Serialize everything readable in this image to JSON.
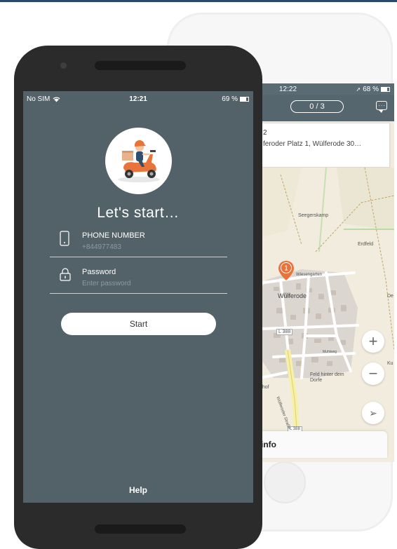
{
  "colors": {
    "screen_bg": "#536269",
    "accent": "#e8743b",
    "map_bg": "#f1ecde",
    "header_bg": "#55666e"
  },
  "front": {
    "status": {
      "carrier": "No SIM",
      "time": "12:21",
      "battery": "69 %"
    },
    "title": "Let's start…",
    "phone_field": {
      "label": "PHONE NUMBER",
      "placeholder": "+844977483",
      "icon": "phone-icon"
    },
    "password_field": {
      "label": "Password",
      "placeholder": "Enter password",
      "icon": "lock-icon"
    },
    "start_label": "Start",
    "help_label": "Help"
  },
  "back": {
    "status": {
      "time": "12:22",
      "battery": "68 %"
    },
    "progress": "0 / 3",
    "address": {
      "number": "2",
      "text": "feroder Platz 1, Wülferode 30…"
    },
    "map_labels": {
      "seegerskamp": "Seegerskamp",
      "erdfeld": "Erdfeld",
      "wesengarten": "Wiesengarten",
      "town": "Wülferode",
      "road1": "L 388",
      "road2": "L 388",
      "feld": "Feld hinter dem Dorfe",
      "edge_de": "De",
      "edge_ku": "Ku",
      "hof": "nhof",
      "street": "Wülferoder Straße",
      "muehlwe": "Muhlweg"
    },
    "marker_number": "1",
    "info_label": "info"
  }
}
